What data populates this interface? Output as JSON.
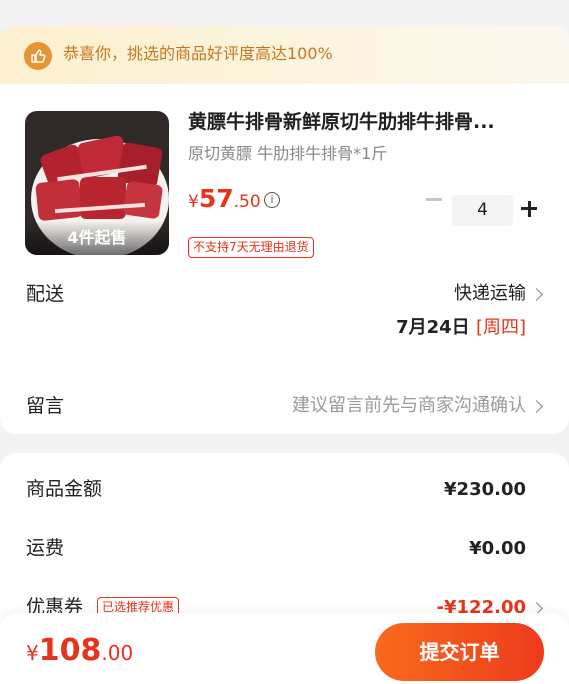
{
  "banner": {
    "icon": "thumbs-up-icon",
    "text": "恭喜你，挑选的商品好评度高达100%"
  },
  "product": {
    "image_badge": "4件起售",
    "title": "黄膘牛排骨新鲜原切牛肋排牛排骨...",
    "spec": "原切黄膘 牛肋排牛排骨*1斤",
    "price_currency": "¥",
    "price_integer": "57",
    "price_decimal": ".50",
    "info_icon": "info-icon",
    "return_tag": "不支持7天无理由退货",
    "quantity": "4",
    "minus_icon": "minus-icon",
    "plus_icon": "plus-icon"
  },
  "delivery": {
    "label": "配送",
    "method": "快递运输",
    "date": "7月24日",
    "weekday": "[周四]"
  },
  "message": {
    "label": "留言",
    "placeholder": "建议留言前先与商家沟通确认"
  },
  "summary": {
    "goods_label": "商品金额",
    "goods_value": "¥230.00",
    "shipping_label": "运费",
    "shipping_value": "¥0.00",
    "coupon_label": "优惠券",
    "coupon_tag": "已选推荐优惠",
    "coupon_value": "-¥122.00"
  },
  "footer": {
    "total_currency": "¥",
    "total_integer": "108",
    "total_decimal": ".00",
    "submit_label": "提交订单"
  },
  "colors": {
    "accent_red": "#e8331b",
    "banner_orange": "#e59532",
    "button_gradient_start": "#f96a1c",
    "button_gradient_end": "#ee3b1d"
  }
}
